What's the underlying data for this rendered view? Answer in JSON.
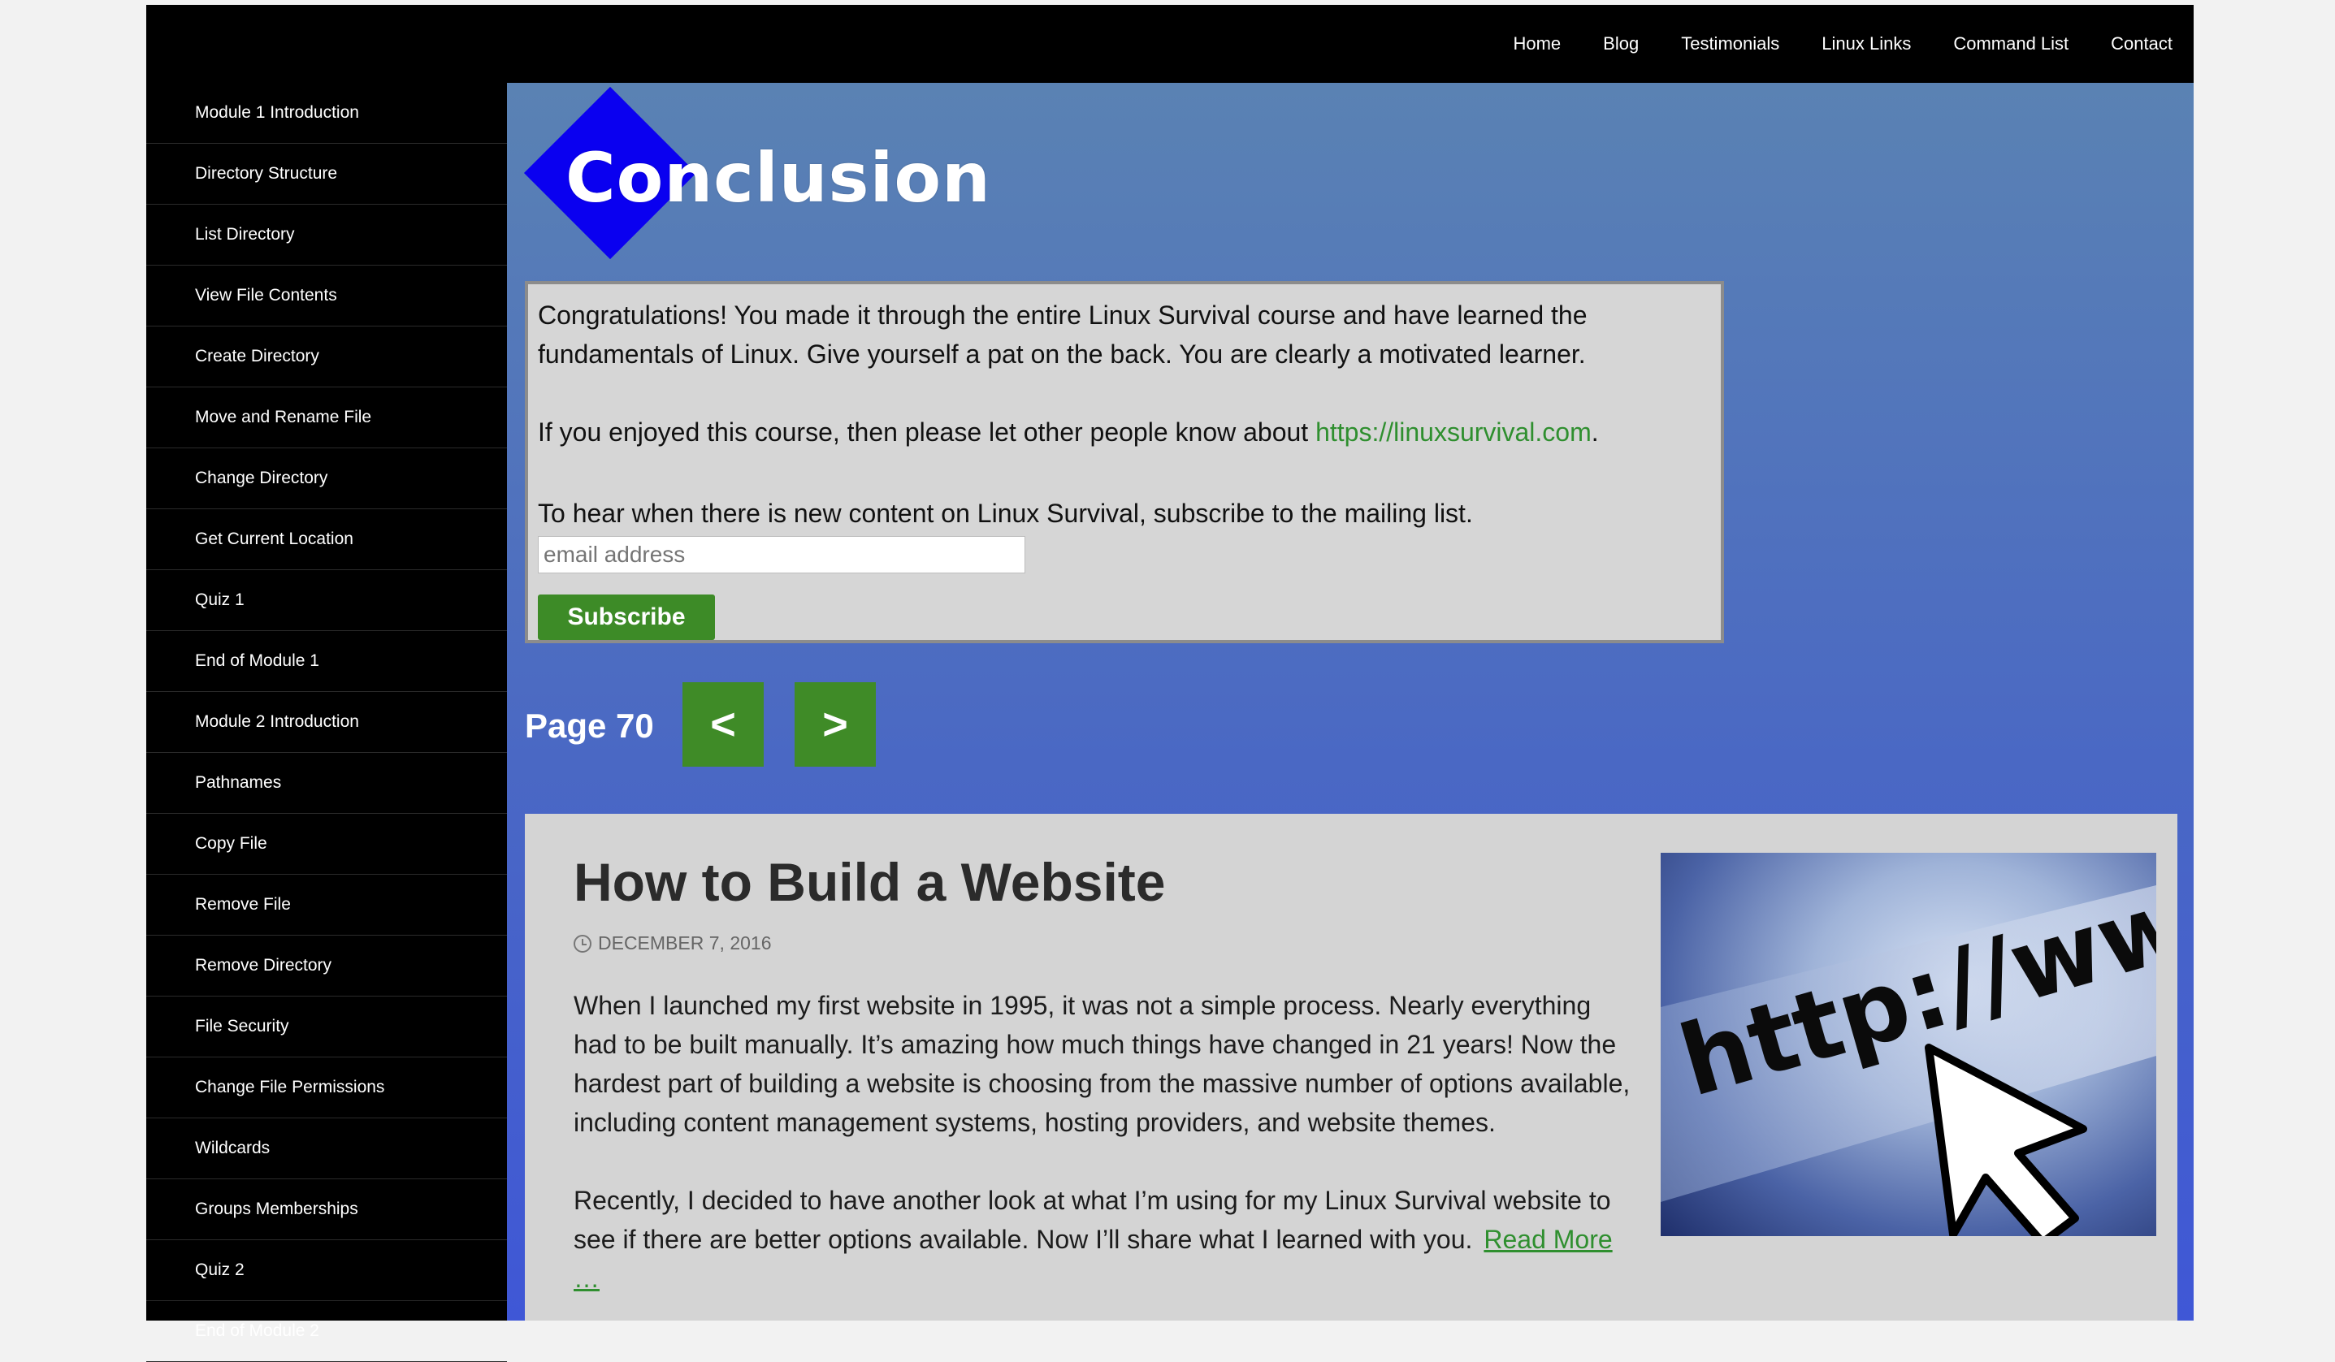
{
  "nav": {
    "items": [
      "Home",
      "Blog",
      "Testimonials",
      "Linux Links",
      "Command List",
      "Contact"
    ]
  },
  "sidebar": {
    "items": [
      "Module 1 Introduction",
      "Directory Structure",
      "List Directory",
      "View File Contents",
      "Create Directory",
      "Move and Rename File",
      "Change Directory",
      "Get Current Location",
      "Quiz 1",
      "End of Module 1",
      "Module 2 Introduction",
      "Pathnames",
      "Copy File",
      "Remove File",
      "Remove Directory",
      "File Security",
      "Change File Permissions",
      "Wildcards",
      "Groups Memberships",
      "Quiz 2",
      "End of Module 2"
    ]
  },
  "logo": {
    "text": "Conclusion",
    "diamond_color": "#0a00f0"
  },
  "panel": {
    "p1": "Congratulations! You made it through the entire Linux Survival course and have learned the fundamentals of Linux. Give yourself a pat on the back. You are clearly a motivated learner.",
    "p2_before": "If you enjoyed this course, then please let other people know about ",
    "p2_link": "https://linuxsurvival.com",
    "p2_after": ".",
    "p3": "To hear when there is new content on Linux Survival, subscribe to the mailing list.",
    "email_placeholder": "email address",
    "subscribe_label": "Subscribe"
  },
  "pager": {
    "label": "Page 70",
    "prev": "<",
    "next": ">"
  },
  "article": {
    "title": "How to Build a Website",
    "date": "DECEMBER 7, 2016",
    "p1": "When I launched my first website in 1995, it was not a simple process. Nearly everything had to be built manually. It’s amazing how much things have changed in 21 years! Now the hardest part of building a website is choosing from the massive number of options available, including content management systems, hosting providers, and website themes.",
    "p2": "Recently, I decided to have another look at what I’m using for my Linux Survival website to see if there are better options available. Now I’ll share what I learned with you.",
    "read_more": "Read More …",
    "image_text": "http://www"
  },
  "colors": {
    "accent_green": "#3d8b27",
    "link_green": "#2f8f2f",
    "content_bg_top": "#5a82b3",
    "content_bg_bottom": "#3f57d6"
  }
}
